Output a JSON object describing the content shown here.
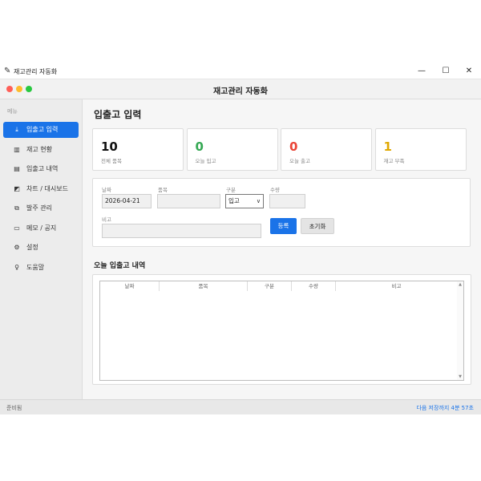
{
  "window": {
    "title": "재고관리 자동화"
  },
  "app": {
    "title": "재고관리 자동화"
  },
  "colors": {
    "accent": "#1a73e8",
    "black": "#111111",
    "green": "#34a853",
    "red": "#ea4335",
    "amber": "#e0a800"
  },
  "sidebar": {
    "header": "메뉴",
    "items": [
      {
        "label": "입출고 입력",
        "icon": "inbox-download-icon",
        "glyph": "⤓",
        "active": true
      },
      {
        "label": "재고 현황",
        "icon": "bar-chart-icon",
        "glyph": "▥",
        "active": false
      },
      {
        "label": "입출고 내역",
        "icon": "clipboard-icon",
        "glyph": "▤",
        "active": false
      },
      {
        "label": "차트 / 대시보드",
        "icon": "trend-chart-icon",
        "glyph": "◩",
        "active": false
      },
      {
        "label": "발주 관리",
        "icon": "copy-icon",
        "glyph": "⧉",
        "active": false
      },
      {
        "label": "메모 / 공지",
        "icon": "document-icon",
        "glyph": "▭",
        "active": false
      },
      {
        "label": "설정",
        "icon": "gear-icon",
        "glyph": "⚙",
        "active": false
      },
      {
        "label": "도움말",
        "icon": "lightbulb-icon",
        "glyph": "♀",
        "active": false
      }
    ]
  },
  "main": {
    "title": "입출고 입력",
    "cards": [
      {
        "value": "10",
        "label": "전체 품목",
        "color": "#111111"
      },
      {
        "value": "0",
        "label": "오늘 입고",
        "color": "#34a853"
      },
      {
        "value": "0",
        "label": "오늘 출고",
        "color": "#ea4335"
      },
      {
        "value": "1",
        "label": "재고 부족",
        "color": "#e0a800"
      }
    ],
    "form": {
      "date_label": "날짜",
      "date_value": "2026-04-21",
      "item_label": "품목",
      "item_value": "",
      "type_label": "구분",
      "type_value": "입고",
      "qty_label": "수량",
      "qty_value": "",
      "note_label": "비고",
      "note_value": "",
      "register_button": "등록",
      "reset_button": "초기화"
    },
    "today_section": {
      "title": "오늘 입출고 내역",
      "columns": [
        "날짜",
        "품목",
        "구분",
        "수량",
        "비고"
      ]
    }
  },
  "status": {
    "left": "준비됨",
    "right": "다음 저장까지  4분 57초"
  }
}
